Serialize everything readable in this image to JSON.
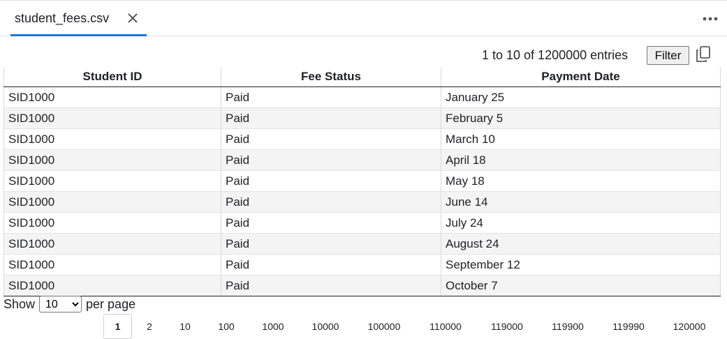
{
  "tab": {
    "title": "student_fees.csv"
  },
  "toolbar": {
    "entries_text": "1 to 10 of 1200000 entries",
    "filter_label": "Filter"
  },
  "table": {
    "columns": [
      "Student ID",
      "Fee Status",
      "Payment Date"
    ],
    "rows": [
      [
        "SID1000",
        "Paid",
        "January 25"
      ],
      [
        "SID1000",
        "Paid",
        "February 5"
      ],
      [
        "SID1000",
        "Paid",
        "March 10"
      ],
      [
        "SID1000",
        "Paid",
        "April 18"
      ],
      [
        "SID1000",
        "Paid",
        "May 18"
      ],
      [
        "SID1000",
        "Paid",
        "June 14"
      ],
      [
        "SID1000",
        "Paid",
        "July 24"
      ],
      [
        "SID1000",
        "Paid",
        "August 24"
      ],
      [
        "SID1000",
        "Paid",
        "September 12"
      ],
      [
        "SID1000",
        "Paid",
        "October 7"
      ]
    ]
  },
  "pagination": {
    "show_label": "Show",
    "per_page_label": "per page",
    "per_page_value": "10",
    "pages": [
      "1",
      "2",
      "10",
      "100",
      "1000",
      "10000",
      "100000",
      "110000",
      "119000",
      "119900",
      "119990",
      "120000"
    ],
    "active_page": "1"
  },
  "icons": {
    "close": "close-icon",
    "more": "more-icon",
    "copy": "copy-icon"
  },
  "colors": {
    "accent": "#1a73e8",
    "row_stripe": "#f4f4f4"
  }
}
